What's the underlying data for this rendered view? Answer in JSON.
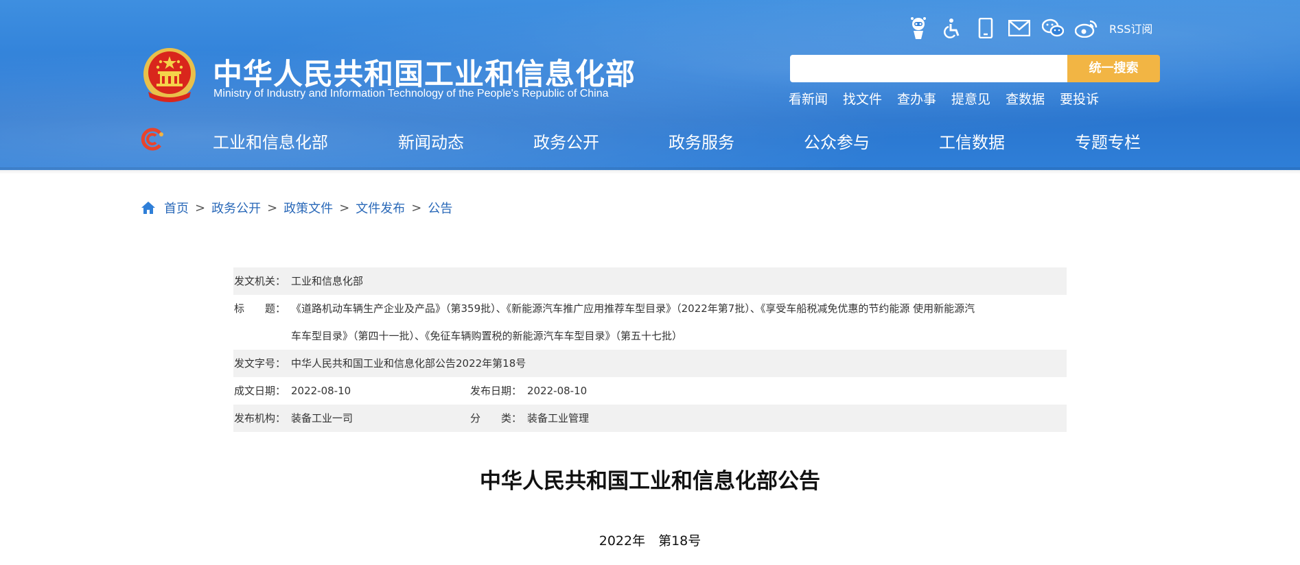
{
  "header": {
    "title": "中华人民共和国工业和信息化部",
    "subtitle": "Ministry of Industry and Information Technology of the People's Republic of China",
    "icons": [
      "robot-icon",
      "accessibility-icon",
      "mobile-icon",
      "mail-icon",
      "wechat-icon",
      "weibo-icon"
    ],
    "rss_label": "RSS订阅",
    "search": {
      "placeholder": "",
      "button_label": "统一搜索"
    },
    "quick_links": [
      "看新闻",
      "找文件",
      "查办事",
      "提意见",
      "查数据",
      "要投诉"
    ],
    "nav": [
      "工业和信息化部",
      "新闻动态",
      "政务公开",
      "政务服务",
      "公众参与",
      "工信数据",
      "专题专栏"
    ],
    "colors": {
      "header_blue": "#2f7fd8",
      "search_button": "#f2b544",
      "link_blue": "#2968b8"
    }
  },
  "breadcrumb": [
    "首页",
    "政务公开",
    "政策文件",
    "文件发布",
    "公告"
  ],
  "meta": {
    "issuer_label": "发文机关：",
    "issuer": "工业和信息化部",
    "title_label": "标　　题：",
    "title_line1": "《道路机动车辆生产企业及产品》（第359批）、《新能源汽车推广应用推荐车型目录》（2022年第7批）、《享受车船税减免优惠的节约能源 使用新能源汽",
    "title_line2": "车车型目录》（第四十一批）、《免征车辆购置税的新能源汽车车型目录》（第五十七批）",
    "doc_no_label": "发文字号：",
    "doc_no": "中华人民共和国工业和信息化部公告2022年第18号",
    "written_date_label": "成文日期：",
    "written_date": "2022-08-10",
    "publish_date_label": "发布日期：",
    "publish_date": "2022-08-10",
    "publisher_label": "发布机构：",
    "publisher": "装备工业一司",
    "category_label": "分　　类：",
    "category": "装备工业管理"
  },
  "document": {
    "heading": "中华人民共和国工业和信息化部公告",
    "number": "2022年　第18号"
  }
}
